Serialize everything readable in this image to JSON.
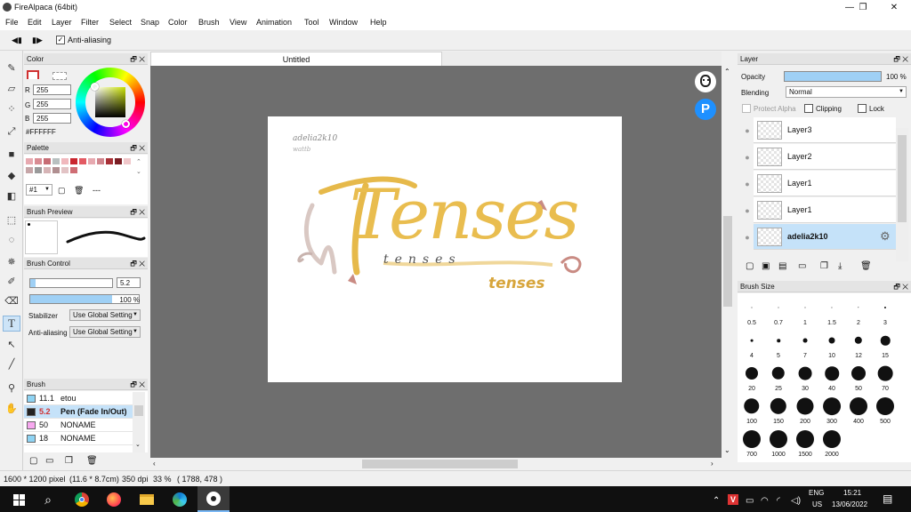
{
  "window": {
    "title": "FireAlpaca (64bit)",
    "min": "—",
    "max": "❐",
    "close": "✕"
  },
  "menu": [
    "File",
    "Edit",
    "Layer",
    "Filter",
    "Select",
    "Snap",
    "Color",
    "Brush",
    "View",
    "Animation",
    "Tool",
    "Window",
    "Help"
  ],
  "toolopts": {
    "anti_aliasing": "Anti-aliasing"
  },
  "color_panel": {
    "title": "Color",
    "r_label": "R",
    "g_label": "G",
    "b_label": "B",
    "r": "255",
    "g": "255",
    "b": "255",
    "hex": "#FFFFFF"
  },
  "palette_panel": {
    "title": "Palette",
    "selector": "#1",
    "dots": "---",
    "colors": [
      "#e7a9b0",
      "#d98c93",
      "#c76d75",
      "#b8c0c0",
      "#f0b8bd",
      "#c9262f",
      "#e35a63",
      "#e7a9b0",
      "#d0848c",
      "#a83036",
      "#7a1e24",
      "#f0c7ca",
      "#c6a6a8",
      "#9a9a9a",
      "#d6b4b6",
      "#b08f91",
      "#e2c3c5",
      "#cf6d74"
    ]
  },
  "brush_preview": {
    "title": "Brush Preview"
  },
  "brush_control": {
    "title": "Brush Control",
    "size": "5.2",
    "opacity": "100 %",
    "stabilizer_label": "Stabilizer",
    "stabilizer_value": "Use Global Setting",
    "aa_label": "Anti-aliasing",
    "aa_value": "Use Global Setting",
    "size_fraction": 0.05,
    "opacity_fraction": 1.0
  },
  "brush_panel": {
    "title": "Brush",
    "items": [
      {
        "size": "11.1",
        "name": "etou",
        "color": "#8ed3f3"
      },
      {
        "size": "5.2",
        "name": "Pen (Fade In/Out)",
        "color": "#222222"
      },
      {
        "size": "50",
        "name": "NONAME",
        "color": "#f7a8ef"
      },
      {
        "size": "18",
        "name": "NONAME",
        "color": "#8ed3f3"
      }
    ]
  },
  "document": {
    "tab": "Untitled"
  },
  "art": {
    "sig": "adelia2k10",
    "sig2": "wattb",
    "title": "Tenses",
    "sub": "tenses",
    "sub2": "tenses"
  },
  "layer_panel": {
    "title": "Layer",
    "opacity_label": "Opacity",
    "opacity_value": "100 %",
    "opacity_fraction": 1.0,
    "blending_label": "Blending",
    "blending_value": "Normal",
    "protect_alpha": "Protect Alpha",
    "clipping": "Clipping",
    "lock": "Lock",
    "layers": [
      "Layer3",
      "Layer2",
      "Layer1",
      "Layer1",
      "adelia2k10"
    ]
  },
  "brush_size_panel": {
    "title": "Brush Size",
    "sizes": [
      {
        "v": 0.5,
        "label": "0.5"
      },
      {
        "v": 0.7,
        "label": "0.7"
      },
      {
        "v": 1,
        "label": "1"
      },
      {
        "v": 1.5,
        "label": "1.5"
      },
      {
        "v": 2,
        "label": "2"
      },
      {
        "v": 3,
        "label": "3"
      },
      {
        "v": 4,
        "label": "4"
      },
      {
        "v": 5,
        "label": "5"
      },
      {
        "v": 7,
        "label": "7"
      },
      {
        "v": 10,
        "label": "10"
      },
      {
        "v": 12,
        "label": "12"
      },
      {
        "v": 15,
        "label": "15"
      },
      {
        "v": 20,
        "label": "20"
      },
      {
        "v": 25,
        "label": "25"
      },
      {
        "v": 30,
        "label": "30"
      },
      {
        "v": 40,
        "label": "40"
      },
      {
        "v": 50,
        "label": "50"
      },
      {
        "v": 70,
        "label": "70"
      },
      {
        "v": 100,
        "label": "100"
      },
      {
        "v": 150,
        "label": "150"
      },
      {
        "v": 200,
        "label": "200"
      },
      {
        "v": 300,
        "label": "300"
      },
      {
        "v": 400,
        "label": "400"
      },
      {
        "v": 500,
        "label": "500"
      },
      {
        "v": 700,
        "label": "700"
      },
      {
        "v": 1000,
        "label": "1000"
      },
      {
        "v": 1500,
        "label": "1500"
      },
      {
        "v": 2000,
        "label": "2000"
      }
    ]
  },
  "status": {
    "dims": "1600 * 1200 pixel",
    "cm": "(11.6 * 8.7cm)",
    "dpi": "350 dpi",
    "zoom": "33 %",
    "coords": "( 1788, 478 )"
  },
  "taskbar": {
    "lang": "ENG",
    "region": "US",
    "time": "15:21",
    "date": "13/06/2022",
    "chevron": "⌃",
    "tray_v": "V"
  }
}
